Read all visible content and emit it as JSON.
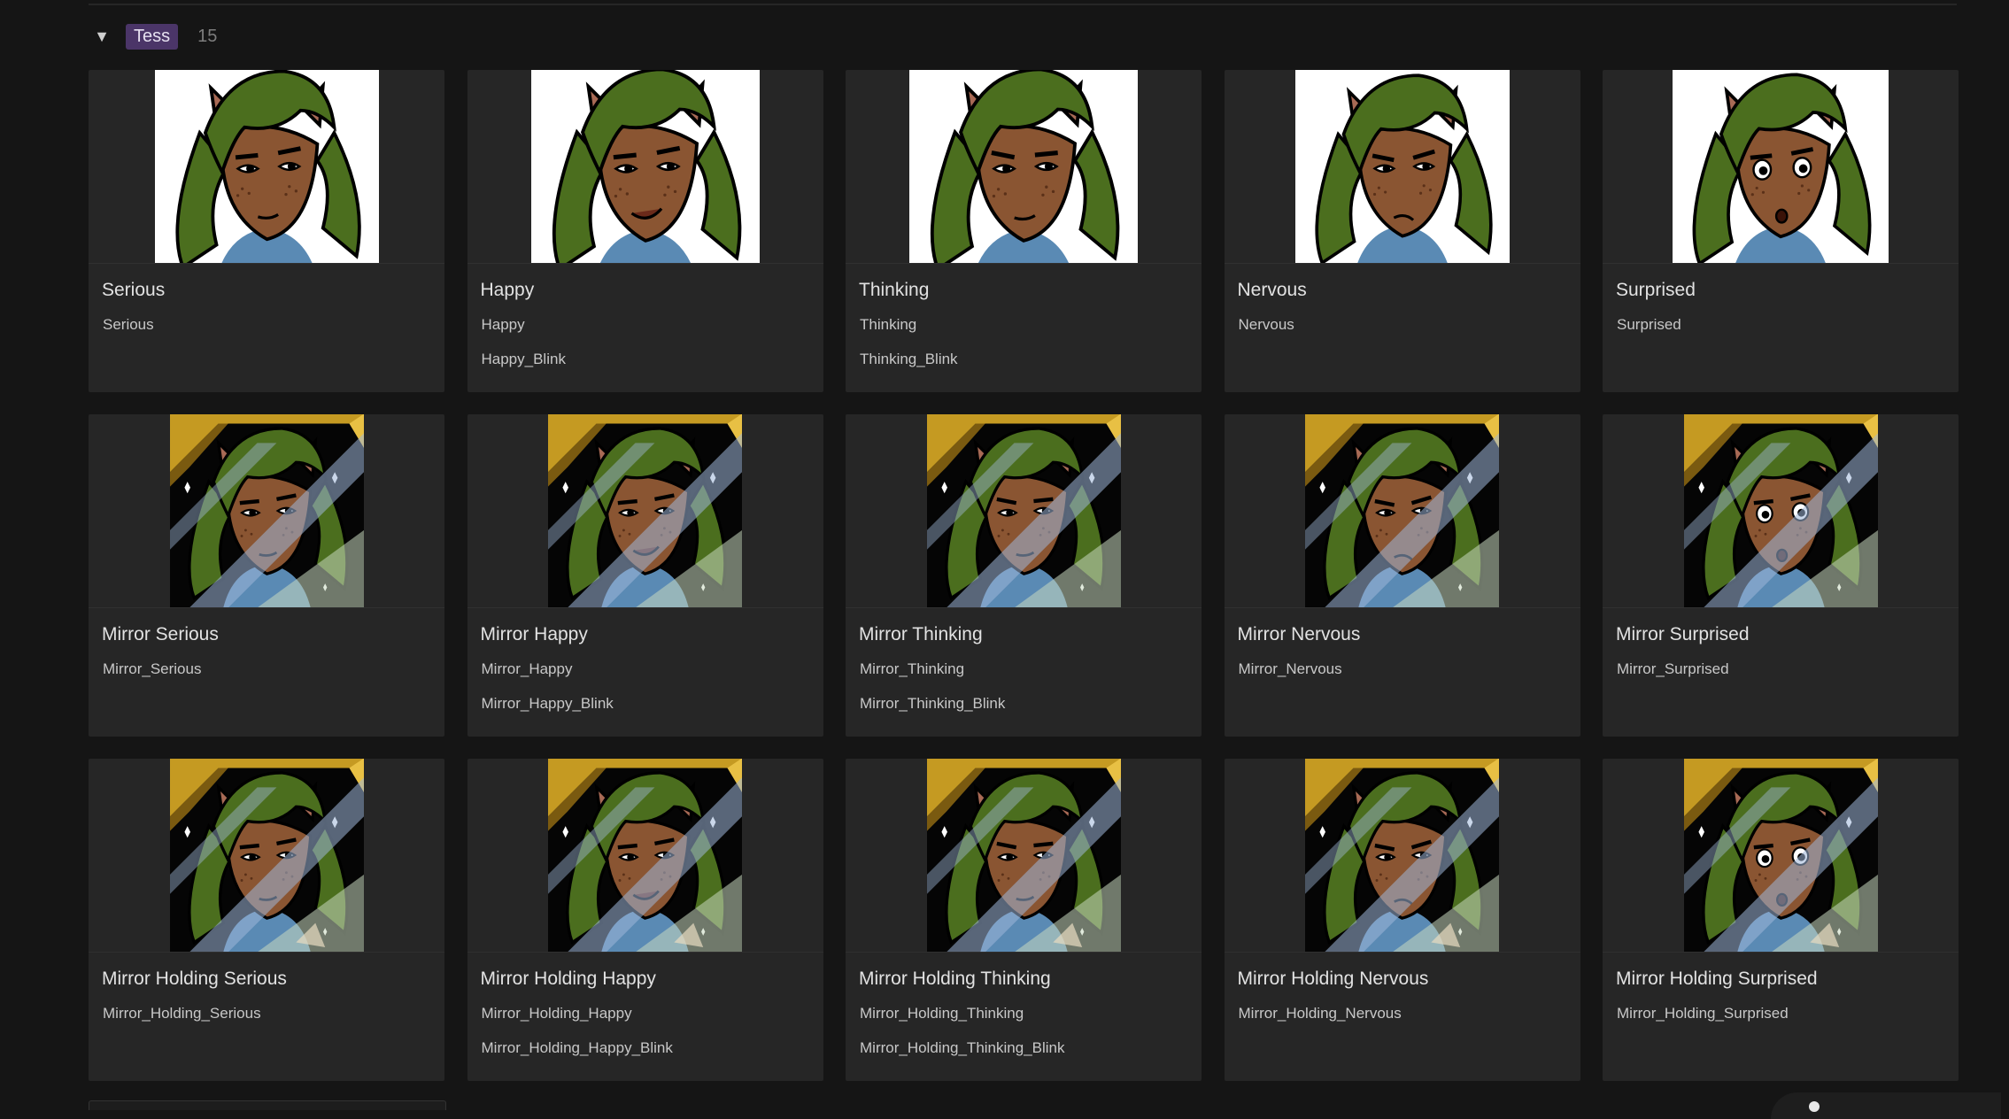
{
  "group": {
    "name": "Tess",
    "count": "15",
    "toggle_icon": "triangle-down-icon"
  },
  "colors": {
    "background": "#151515",
    "card": "#262626",
    "tag": "#4b3568",
    "hair": "#4b6e1e",
    "skin": "#8a5532",
    "mirror_frame": "#b88a1c"
  },
  "cards": [
    {
      "title": "Serious",
      "variants": [
        "Serious"
      ],
      "style": "plain",
      "expression": "serious"
    },
    {
      "title": "Happy",
      "variants": [
        "Happy",
        "Happy_Blink"
      ],
      "style": "plain",
      "expression": "happy"
    },
    {
      "title": "Thinking",
      "variants": [
        "Thinking",
        "Thinking_Blink"
      ],
      "style": "plain",
      "expression": "thinking"
    },
    {
      "title": "Nervous",
      "variants": [
        "Nervous"
      ],
      "style": "plain",
      "expression": "nervous"
    },
    {
      "title": "Surprised",
      "variants": [
        "Surprised"
      ],
      "style": "plain",
      "expression": "surprised"
    },
    {
      "title": "Mirror Serious",
      "variants": [
        "Mirror_Serious"
      ],
      "style": "mirror",
      "expression": "serious"
    },
    {
      "title": "Mirror Happy",
      "variants": [
        "Mirror_Happy",
        "Mirror_Happy_Blink"
      ],
      "style": "mirror",
      "expression": "happy"
    },
    {
      "title": "Mirror Thinking",
      "variants": [
        "Mirror_Thinking",
        "Mirror_Thinking_Blink"
      ],
      "style": "mirror",
      "expression": "thinking"
    },
    {
      "title": "Mirror Nervous",
      "variants": [
        "Mirror_Nervous"
      ],
      "style": "mirror",
      "expression": "nervous"
    },
    {
      "title": "Mirror Surprised",
      "variants": [
        "Mirror_Surprised"
      ],
      "style": "mirror",
      "expression": "surprised"
    },
    {
      "title": "Mirror Holding Serious",
      "variants": [
        "Mirror_Holding_Serious"
      ],
      "style": "mirror-holding",
      "expression": "serious"
    },
    {
      "title": "Mirror Holding Happy",
      "variants": [
        "Mirror_Holding_Happy",
        "Mirror_Holding_Happy_Blink"
      ],
      "style": "mirror-holding",
      "expression": "happy"
    },
    {
      "title": "Mirror Holding Thinking",
      "variants": [
        "Mirror_Holding_Thinking",
        "Mirror_Holding_Thinking_Blink"
      ],
      "style": "mirror-holding",
      "expression": "thinking"
    },
    {
      "title": "Mirror Holding Nervous",
      "variants": [
        "Mirror_Holding_Nervous"
      ],
      "style": "mirror-holding",
      "expression": "nervous"
    },
    {
      "title": "Mirror Holding Surprised",
      "variants": [
        "Mirror_Holding_Surprised"
      ],
      "style": "mirror-holding",
      "expression": "surprised"
    }
  ]
}
